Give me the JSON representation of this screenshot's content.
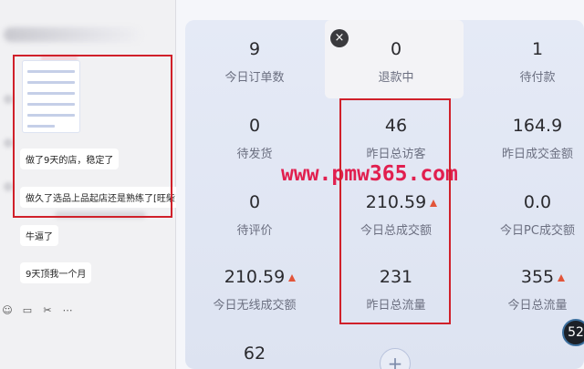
{
  "chat": {
    "messages": [
      "做了9天的店，稳定了",
      "做久了选品上品起店还是熟练了[旺柴]",
      "牛逼了",
      "9天顶我一个月"
    ],
    "toolbar_icons": [
      "emoji-icon",
      "folder-icon",
      "scissors-icon",
      "chat-bubble-icon"
    ]
  },
  "close_label": "×",
  "stats": [
    {
      "value": "9",
      "label": "今日订单数"
    },
    {
      "value": "0",
      "label": "退款中"
    },
    {
      "value": "1",
      "label": "待付款"
    },
    {
      "value": "0",
      "label": "待发货"
    },
    {
      "value": "46",
      "label": "昨日总访客"
    },
    {
      "value": "164.9",
      "label": "昨日成交金额"
    },
    {
      "value": "0",
      "label": "待评价"
    },
    {
      "value": "210.59",
      "label": "今日总成交额",
      "trend": "up"
    },
    {
      "value": "0.0",
      "label": "今日PC成交额"
    },
    {
      "value": "210.59",
      "label": "今日无线成交额",
      "trend": "up"
    },
    {
      "value": "231",
      "label": "昨日总流量"
    },
    {
      "value": "355",
      "label": "今日总流量",
      "trend": "up"
    },
    {
      "value": "62",
      "label": ""
    }
  ],
  "watermark": "www.pmw365.com",
  "add_label": "+",
  "badge": "52",
  "colors": {
    "highlight": "#d0202a",
    "trend_up": "#e2553a",
    "watermark": "#e11f4f"
  }
}
